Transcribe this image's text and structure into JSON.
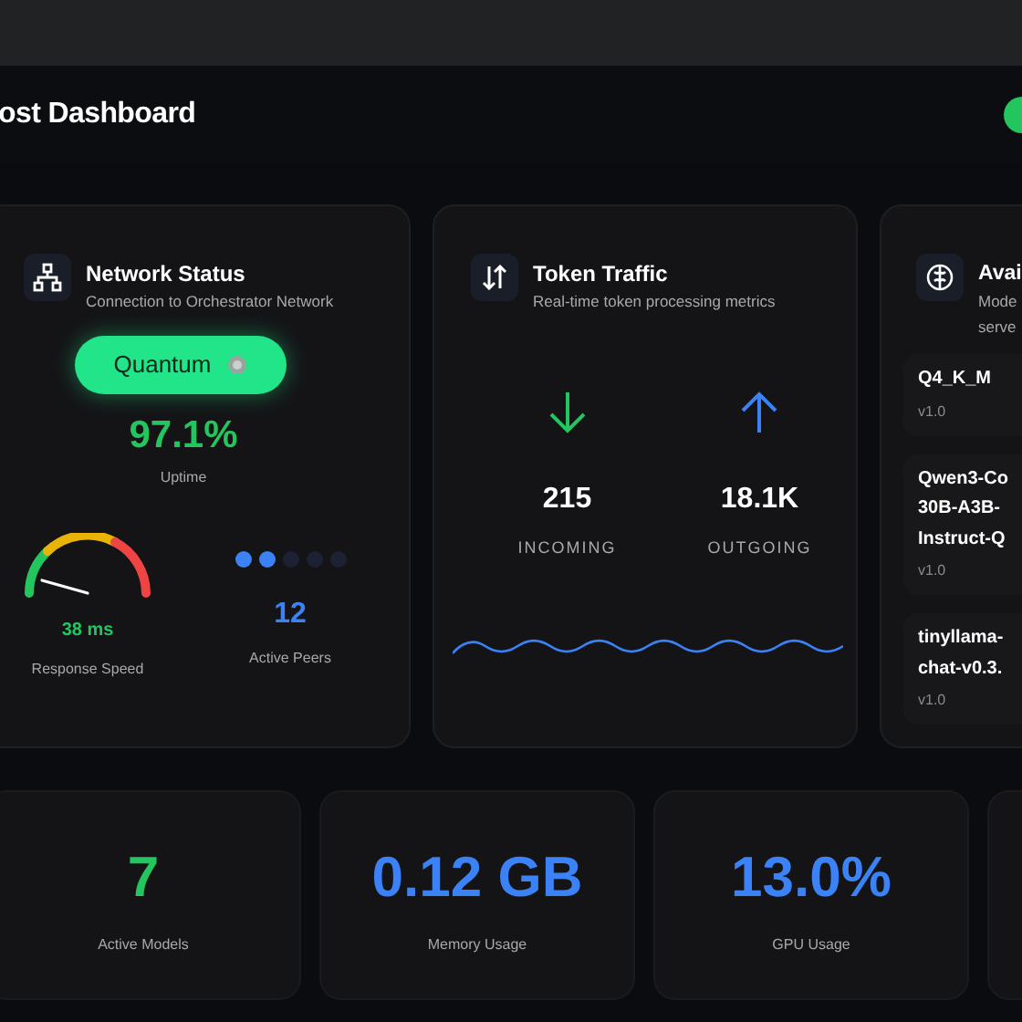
{
  "header": {
    "title": "ost Dashboard",
    "toggle": {
      "on": true
    }
  },
  "network": {
    "title": "Network Status",
    "subtitle": "Connection to Orchestrator Network",
    "mode": "Quantum",
    "uptime": "97.1%",
    "uptime_label": "Uptime",
    "speed": {
      "reading": "38 ms",
      "label": "Response Speed"
    },
    "peers": {
      "dots": [
        {
          "on": true
        },
        {
          "on": true
        },
        {
          "on": false
        },
        {
          "on": false
        },
        {
          "on": false
        }
      ],
      "count": "12",
      "label": "Active Peers"
    }
  },
  "traffic": {
    "title": "Token Traffic",
    "subtitle": "Real-time token processing metrics",
    "stats": [
      {
        "kind": "incoming",
        "value": "215",
        "label": "INCOMING"
      },
      {
        "kind": "outgoing",
        "value": "18.1K",
        "label": "OUTGOING"
      }
    ]
  },
  "models": {
    "title": "Avai",
    "subtitle_lines": [
      "Mode",
      "serve"
    ],
    "items": [
      {
        "name_lines": [
          "Q4_K_M"
        ],
        "version": "v1.0"
      },
      {
        "name_lines": [
          "Qwen3-Co",
          "30B-A3B-",
          "Instruct-Q"
        ],
        "version": "v1.0"
      },
      {
        "name_lines": [
          "tinyllama-",
          "chat-v0.3."
        ],
        "version": "v1.0"
      }
    ]
  },
  "stats": [
    {
      "kind": "stat",
      "value": "7",
      "label": "Active Models",
      "color": "#22c55e"
    },
    {
      "kind": "stat",
      "value": "0.12 GB",
      "label": "Memory Usage",
      "color": "#3b82f6"
    },
    {
      "kind": "stat",
      "value": "13.0%",
      "label": "GPU Usage",
      "color": "#3b82f6"
    },
    {
      "kind": "empty"
    }
  ]
}
